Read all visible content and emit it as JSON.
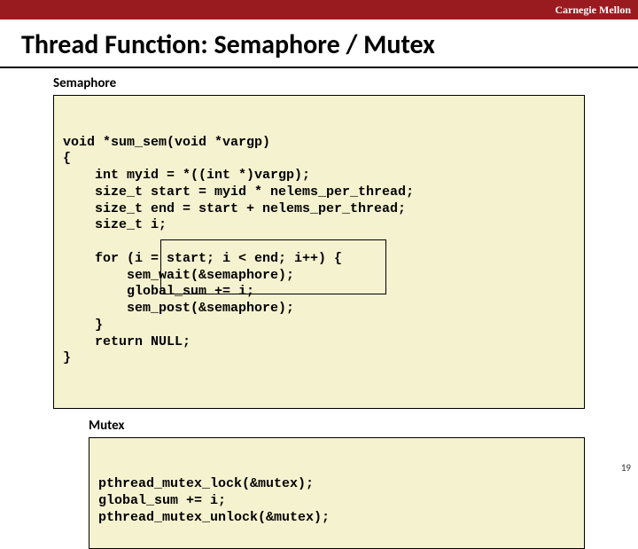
{
  "header": {
    "brand": "Carnegie Mellon"
  },
  "title": "Thread Function: Semaphore / Mutex",
  "labels": {
    "semaphore": "Semaphore",
    "mutex": "Mutex"
  },
  "code": {
    "semaphore": "void *sum_sem(void *vargp)\n{\n    int myid = *((int *)vargp);\n    size_t start = myid * nelems_per_thread;\n    size_t end = start + nelems_per_thread;\n    size_t i;\n\n    for (i = start; i < end; i++) {\n        sem_wait(&semaphore);\n        global_sum += i;\n        sem_post(&semaphore);\n    }\n    return NULL;\n}",
    "mutex": "pthread_mutex_lock(&mutex);\nglobal_sum += i;\npthread_mutex_unlock(&mutex);"
  },
  "page_number": "19"
}
